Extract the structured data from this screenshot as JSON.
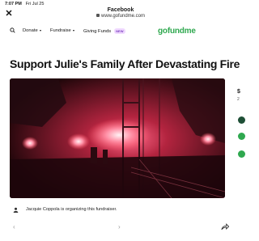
{
  "status_bar": {
    "time": "7:07 PM",
    "date": "Fri Jul 25"
  },
  "header": {
    "title": "Facebook",
    "url": "www.gofundme.com",
    "close_icon": "close-icon"
  },
  "nav": {
    "items": [
      {
        "label": "Donate",
        "dropdown": true
      },
      {
        "label": "Fundraise",
        "dropdown": true
      },
      {
        "label": "Giving Funds",
        "badge": "NEW"
      }
    ],
    "logo": "gofundme",
    "logo_color": "#2fa84f"
  },
  "campaign": {
    "title": "Support Julie's Family After Devastating Fire",
    "organizer_text": "Jacquie Coppola is organizing this fundraiser."
  },
  "side_panel": {
    "amount": "$",
    "sub": "2",
    "dot_colors": [
      "#1e4f36",
      "#2fa84f",
      "#2fa84f"
    ]
  }
}
